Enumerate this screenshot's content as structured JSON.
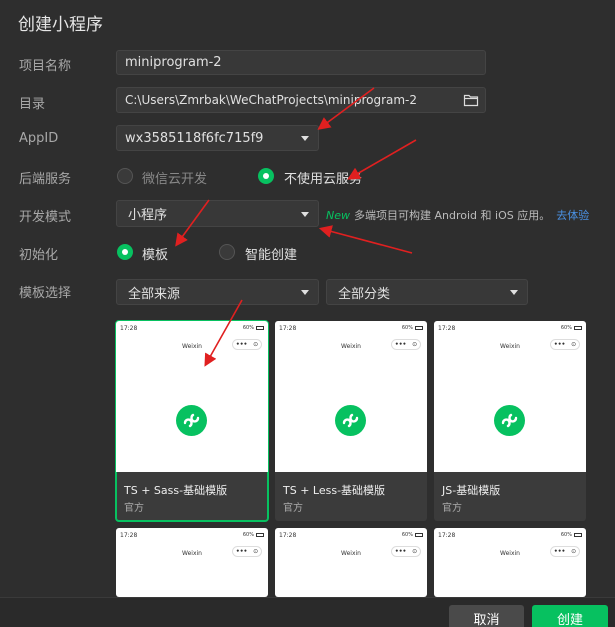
{
  "dialog": {
    "title": "创建小程序"
  },
  "form": {
    "project_name_label": "项目名称",
    "project_name_value": "miniprogram-2",
    "directory_label": "目录",
    "directory_value": "C:\\Users\\Zmrbak\\WeChatProjects\\miniprogram-2",
    "appid_label": "AppID",
    "appid_value": "wx3585118f6fc715f9",
    "backend_label": "后端服务",
    "backend_options": [
      "微信云开发",
      "不使用云服务"
    ],
    "backend_selected": "不使用云服务",
    "dev_mode_label": "开发模式",
    "dev_mode_value": "小程序",
    "dev_mode_hint_new": "New",
    "dev_mode_hint_text": "多端项目可构建 Android 和 iOS 应用。",
    "dev_mode_hint_link": "去体验",
    "init_label": "初始化",
    "init_options": [
      "模板",
      "智能创建"
    ],
    "init_selected": "模板",
    "template_label": "模板选择",
    "source_value": "全部来源",
    "category_value": "全部分类"
  },
  "templates": [
    {
      "title": "TS + Sass-基础模版",
      "source": "官方",
      "selected": true
    },
    {
      "title": "TS + Less-基础模版",
      "source": "官方",
      "selected": false
    },
    {
      "title": "JS-基础模版",
      "source": "官方",
      "selected": false
    }
  ],
  "preview": {
    "time": "17:28",
    "battery": "60%",
    "app_name": "Weixin",
    "capsule_dots": "•••"
  },
  "footer": {
    "cancel_label": "取消",
    "create_label": "创建"
  },
  "colors": {
    "accent": "#07c160",
    "background": "#2e2e2e",
    "annotation_arrow": "#e02020"
  }
}
